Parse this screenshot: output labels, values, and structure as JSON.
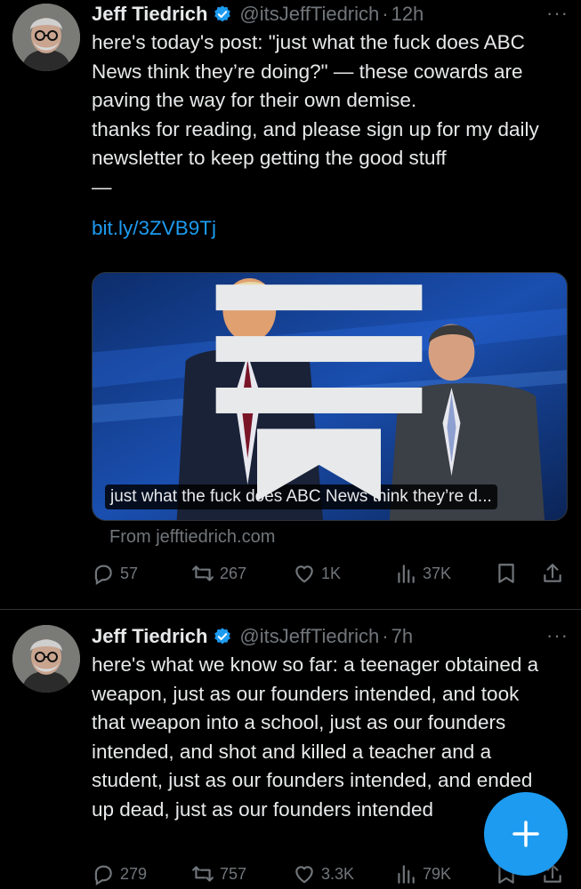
{
  "colors": {
    "background": "#000000",
    "text": "#e7e9ea",
    "secondary": "#71767b",
    "accent": "#1d9bf0",
    "divider": "#2f3336"
  },
  "tweets": [
    {
      "author": {
        "name": "Jeff Tiedrich",
        "handle": "@itsJeffTiedrich",
        "verified": true,
        "avatar_icon": "avatar-photo"
      },
      "separator": "·",
      "time": "12h",
      "more_icon": "more-icon",
      "more_label": "···",
      "text": "here's today's post: \"just what the fuck does ABC News think they’re doing?\" — these cowards are paving the way for their own demise.\nthanks for reading, and please sign up for my daily newsletter to keep getting the good stuff\n—",
      "link": "bit.ly/3ZVB9Tj",
      "card": {
        "title": "just what the fuck does ABC News think they’re d...",
        "source": "From jefftiedrich.com",
        "image_icon": "link-preview-image",
        "article_icon": "article-icon"
      },
      "actions": {
        "replies": "57",
        "reposts": "267",
        "likes": "1K",
        "views": "37K",
        "bookmark_icon": "bookmark-icon",
        "share_icon": "share-icon"
      }
    },
    {
      "author": {
        "name": "Jeff Tiedrich",
        "handle": "@itsJeffTiedrich",
        "verified": true,
        "avatar_icon": "avatar-photo"
      },
      "separator": "·",
      "time": "7h",
      "more_icon": "more-icon",
      "more_label": "···",
      "text": "here's what we know so far: a teenager obtained a weapon, just as our founders intended, and took that weapon into a school, just as our founders intended, and shot and killed a teacher and a student, just as our founders intended, and ended up dead, just as our founders intended",
      "actions": {
        "replies": "279",
        "reposts": "757",
        "likes": "3.3K",
        "views": "79K",
        "bookmark_icon": "bookmark-icon",
        "share_icon": "share-icon"
      }
    }
  ],
  "compose_button": {
    "icon": "plus-icon",
    "label": "+"
  }
}
